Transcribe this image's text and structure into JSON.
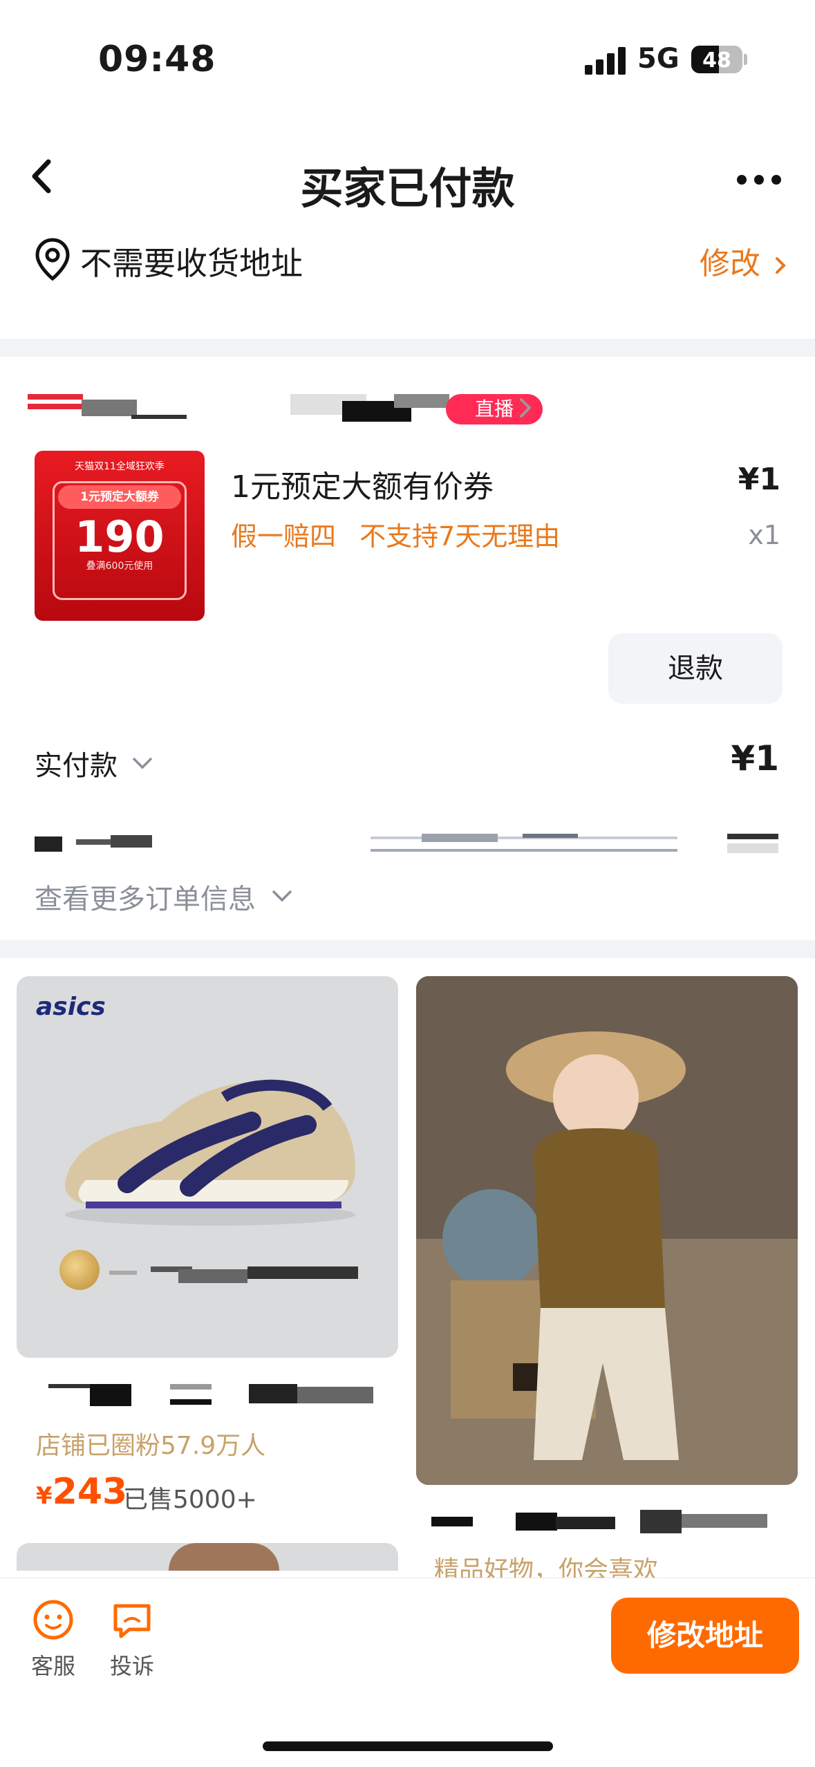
{
  "status_bar": {
    "time": "09:48",
    "network": "5G",
    "battery": "48"
  },
  "nav": {
    "title": "买家已付款"
  },
  "address": {
    "text": "不需要收货地址",
    "edit_label": "修改"
  },
  "store": {
    "live_badge": "直播"
  },
  "product": {
    "thumb_top": "天猫双11全域狂欢季",
    "thumb_line": "1元预定大额券",
    "thumb_price": "190",
    "thumb_sub": "叠满600元使用",
    "title": "1元预定大额有价券",
    "tags": [
      "假一赔四",
      "不支持7天无理由"
    ],
    "price": "¥1",
    "quantity": "x1"
  },
  "actions": {
    "refund": "退款"
  },
  "payment": {
    "label": "实付款",
    "amount": "¥1"
  },
  "order_info": {
    "label": "查看更多订单信息"
  },
  "recommendations": {
    "left": {
      "brand": "asics",
      "fans": "店铺已圈粉57.9万人",
      "currency": "¥",
      "price": "243",
      "sold": "已售5000+"
    },
    "right": {
      "caption": "精品好物，你会喜欢"
    }
  },
  "bottom_bar": {
    "service": "客服",
    "complaint": "投诉",
    "edit_address": "修改地址"
  },
  "colors": {
    "accent_orange": "#ff6a00",
    "tag_orange": "#e9781c",
    "live_red": "#ff2b55"
  },
  "icons": [
    "chevron-left-icon",
    "more-icon",
    "location-pin-icon",
    "chevron-right-icon",
    "chevron-down-icon",
    "customer-service-icon",
    "complaint-icon"
  ]
}
